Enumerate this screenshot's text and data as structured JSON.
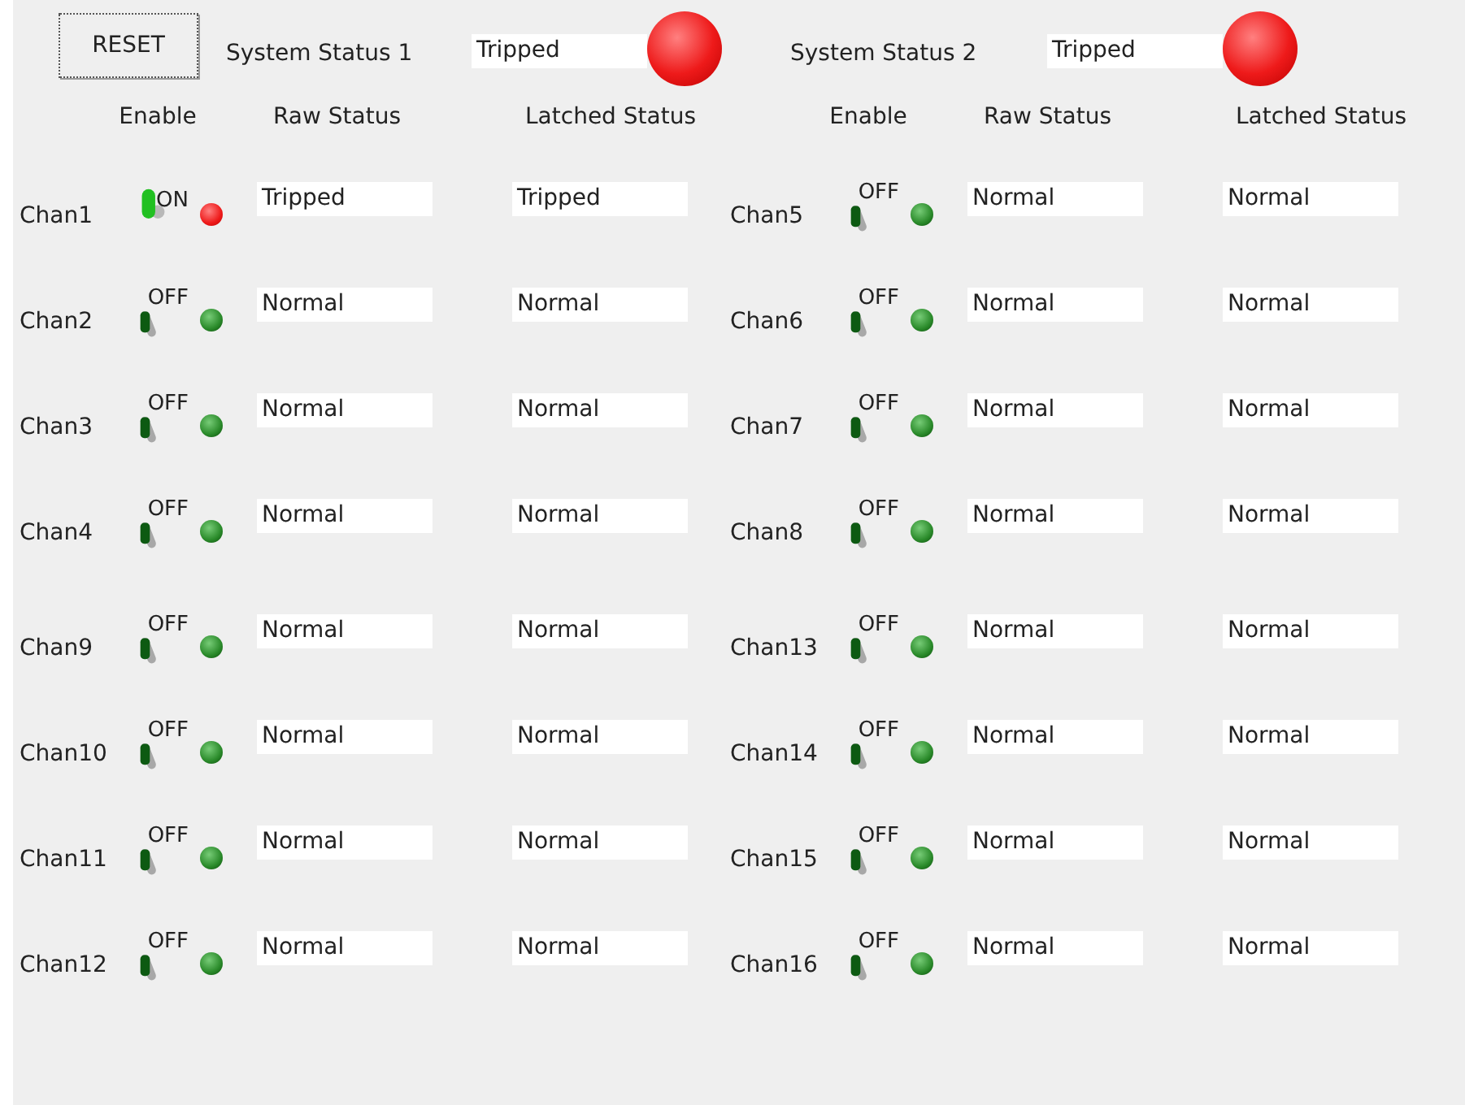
{
  "reset_button": {
    "label": "RESET"
  },
  "system_statuses": [
    {
      "label": "System Status 1",
      "value": "Tripped",
      "tripped": true
    },
    {
      "label": "System Status 2",
      "value": "Tripped",
      "tripped": true
    }
  ],
  "groups": [
    {
      "enable_header": "Enable",
      "raw_header": "Raw Status",
      "latched_header": "Latched Status",
      "channels": [
        {
          "name": "Chan1",
          "enabled": true,
          "switch_label": "ON",
          "raw": "Tripped",
          "raw_tripped": true,
          "latched": "Tripped"
        },
        {
          "name": "Chan2",
          "enabled": false,
          "switch_label": "OFF",
          "raw": "Normal",
          "raw_tripped": false,
          "latched": "Normal"
        },
        {
          "name": "Chan3",
          "enabled": false,
          "switch_label": "OFF",
          "raw": "Normal",
          "raw_tripped": false,
          "latched": "Normal"
        },
        {
          "name": "Chan4",
          "enabled": false,
          "switch_label": "OFF",
          "raw": "Normal",
          "raw_tripped": false,
          "latched": "Normal"
        },
        {
          "name": "Chan9",
          "enabled": false,
          "switch_label": "OFF",
          "raw": "Normal",
          "raw_tripped": false,
          "latched": "Normal"
        },
        {
          "name": "Chan10",
          "enabled": false,
          "switch_label": "OFF",
          "raw": "Normal",
          "raw_tripped": false,
          "latched": "Normal"
        },
        {
          "name": "Chan11",
          "enabled": false,
          "switch_label": "OFF",
          "raw": "Normal",
          "raw_tripped": false,
          "latched": "Normal"
        },
        {
          "name": "Chan12",
          "enabled": false,
          "switch_label": "OFF",
          "raw": "Normal",
          "raw_tripped": false,
          "latched": "Normal"
        }
      ]
    },
    {
      "enable_header": "Enable",
      "raw_header": "Raw Status",
      "latched_header": "Latched Status",
      "channels": [
        {
          "name": "Chan5",
          "enabled": false,
          "switch_label": "OFF",
          "raw": "Normal",
          "raw_tripped": false,
          "latched": "Normal"
        },
        {
          "name": "Chan6",
          "enabled": false,
          "switch_label": "OFF",
          "raw": "Normal",
          "raw_tripped": false,
          "latched": "Normal"
        },
        {
          "name": "Chan7",
          "enabled": false,
          "switch_label": "OFF",
          "raw": "Normal",
          "raw_tripped": false,
          "latched": "Normal"
        },
        {
          "name": "Chan8",
          "enabled": false,
          "switch_label": "OFF",
          "raw": "Normal",
          "raw_tripped": false,
          "latched": "Normal"
        },
        {
          "name": "Chan13",
          "enabled": false,
          "switch_label": "OFF",
          "raw": "Normal",
          "raw_tripped": false,
          "latched": "Normal"
        },
        {
          "name": "Chan14",
          "enabled": false,
          "switch_label": "OFF",
          "raw": "Normal",
          "raw_tripped": false,
          "latched": "Normal"
        },
        {
          "name": "Chan15",
          "enabled": false,
          "switch_label": "OFF",
          "raw": "Normal",
          "raw_tripped": false,
          "latched": "Normal"
        },
        {
          "name": "Chan16",
          "enabled": false,
          "switch_label": "OFF",
          "raw": "Normal",
          "raw_tripped": false,
          "latched": "Normal"
        }
      ]
    }
  ]
}
